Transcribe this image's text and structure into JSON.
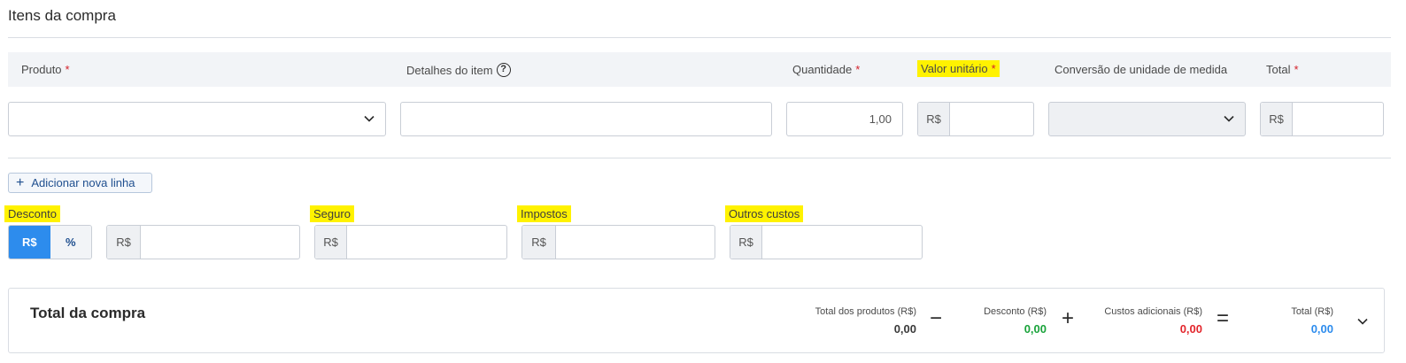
{
  "section": {
    "title": "Itens da compra"
  },
  "columns": {
    "produto": "Produto",
    "detalhes": "Detalhes do item",
    "quantidade": "Quantidade",
    "valor_unitario": "Valor unitário",
    "conversao": "Conversão de unidade de medida",
    "total": "Total",
    "required_mark": "*",
    "help_glyph": "?"
  },
  "row": {
    "produto_value": "",
    "detalhes_value": "",
    "quantidade_value": "1,00",
    "valor_unitario_prefix": "R$",
    "valor_unitario_value": "",
    "conversao_value": "",
    "total_prefix": "R$",
    "total_value": ""
  },
  "actions": {
    "add_line_icon": "+",
    "add_line": "Adicionar nova linha"
  },
  "extras": {
    "desconto_label": "Desconto",
    "desconto_toggle": [
      "R$",
      "%"
    ],
    "desconto_prefix": "R$",
    "seguro_label": "Seguro",
    "seguro_prefix": "R$",
    "impostos_label": "Impostos",
    "impostos_prefix": "R$",
    "outros_label": "Outros custos",
    "outros_prefix": "R$"
  },
  "summary": {
    "title": "Total da compra",
    "produtos_label": "Total dos produtos (R$)",
    "produtos_value": "0,00",
    "minus": "−",
    "desconto_label": "Desconto (R$)",
    "desconto_value": "0,00",
    "plus": "+",
    "custos_label": "Custos adicionais (R$)",
    "custos_value": "0,00",
    "equals": "=",
    "total_label": "Total (R$)",
    "total_value": "0,00"
  },
  "colors": {
    "accent_blue": "#2d8ced",
    "discount_green": "#1aa33b",
    "cost_red": "#e3262c",
    "total_blue": "#2d8ced",
    "highlight": "#fff200"
  }
}
